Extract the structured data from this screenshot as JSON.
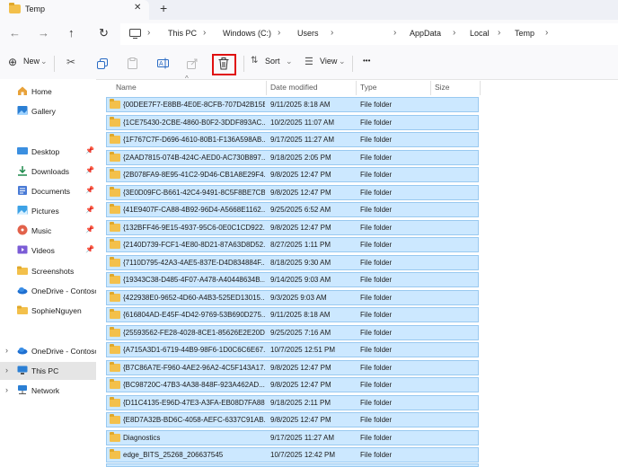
{
  "tab": {
    "title": "Temp",
    "close": "✕",
    "new": "+"
  },
  "nav": {
    "back": "←",
    "forward": "→",
    "up": "↑",
    "refresh": "↻"
  },
  "breadcrumb": [
    {
      "label": "This PC"
    },
    {
      "label": "Windows (C:)"
    },
    {
      "label": "Users"
    },
    {
      "label": "AppData"
    },
    {
      "label": "Local"
    },
    {
      "label": "Temp"
    }
  ],
  "toolbar": {
    "new_label": "New",
    "sort_label": "Sort",
    "view_label": "View",
    "more": "•••"
  },
  "sidebar": [
    {
      "label": "Home",
      "icon": "home-icon"
    },
    {
      "label": "Gallery",
      "icon": "gallery-icon"
    },
    {
      "label": "Desktop",
      "icon": "desktop-icon",
      "pinned": true
    },
    {
      "label": "Downloads",
      "icon": "downloads-icon",
      "pinned": true
    },
    {
      "label": "Documents",
      "icon": "documents-icon",
      "pinned": true
    },
    {
      "label": "Pictures",
      "icon": "pictures-icon",
      "pinned": true
    },
    {
      "label": "Music",
      "icon": "music-icon",
      "pinned": true
    },
    {
      "label": "Videos",
      "icon": "videos-icon",
      "pinned": true
    },
    {
      "label": "Screenshots",
      "icon": "folder-icon"
    },
    {
      "label": "OneDrive - Contoso",
      "icon": "onedrive-icon"
    },
    {
      "label": "SophieNguyen",
      "icon": "folder-icon"
    },
    {
      "label": "OneDrive - Contoso",
      "icon": "onedrive-icon",
      "expander": true
    },
    {
      "label": "This PC",
      "icon": "pc-icon",
      "expander": true,
      "selected": true
    },
    {
      "label": "Network",
      "icon": "network-icon",
      "expander": true
    }
  ],
  "columns": {
    "name": "Name",
    "date": "Date modified",
    "type": "Type",
    "size": "Size"
  },
  "files": [
    {
      "name": "{00DEE7F7-E8BB-4E0E-8CFB-707D42B15B...",
      "date": "9/11/2025 8:18 AM",
      "type": "File folder"
    },
    {
      "name": "{1CE75430-2CBE-4860-B0F2-3DDF893AC...",
      "date": "10/2/2025 11:07 AM",
      "type": "File folder"
    },
    {
      "name": "{1F767C7F-D696-4610-80B1-F136A598AB...",
      "date": "9/17/2025 11:27 AM",
      "type": "File folder"
    },
    {
      "name": "{2AAD7815-074B-424C-AED0-AC730B897...",
      "date": "9/18/2025 2:05 PM",
      "type": "File folder"
    },
    {
      "name": "{2B078FA9-8E95-41C2-9D46-CB1A8E29F4...",
      "date": "9/8/2025 12:47 PM",
      "type": "File folder"
    },
    {
      "name": "{3E0D09FC-B661-42C4-9491-8C5F8BE7CB...",
      "date": "9/8/2025 12:47 PM",
      "type": "File folder"
    },
    {
      "name": "{41E9407F-CA88-4B92-96D4-A5668E1162...",
      "date": "9/25/2025 6:52 AM",
      "type": "File folder"
    },
    {
      "name": "{132BFF46-9E15-4937-95C6-0E0C1CD922...",
      "date": "9/8/2025 12:47 PM",
      "type": "File folder"
    },
    {
      "name": "{2140D739-FCF1-4E80-8D21-87A63D8D52...",
      "date": "8/27/2025 1:11 PM",
      "type": "File folder"
    },
    {
      "name": "{7110D795-42A3-4AE5-837E-D4D834884F...",
      "date": "8/18/2025 9:30 AM",
      "type": "File folder"
    },
    {
      "name": "{19343C38-D485-4F07-A478-A40448634B...",
      "date": "9/14/2025 9:03 AM",
      "type": "File folder"
    },
    {
      "name": "{422938E0-9652-4D60-A4B3-525ED13015...",
      "date": "9/3/2025 9:03 AM",
      "type": "File folder"
    },
    {
      "name": "{616804AD-E45F-4D42-9769-53B690D275...",
      "date": "9/11/2025 8:18 AM",
      "type": "File folder"
    },
    {
      "name": "{25593562-FE28-4028-8CE1-85626E2E20D0}",
      "date": "9/25/2025 7:16 AM",
      "type": "File folder"
    },
    {
      "name": "{A715A3D1-6719-44B9-98F6-1D0C6C6E67...",
      "date": "10/7/2025 12:51 PM",
      "type": "File folder"
    },
    {
      "name": "{B7C86A7E-F960-4AE2-96A2-4C5F143A17...",
      "date": "9/8/2025 12:47 PM",
      "type": "File folder"
    },
    {
      "name": "{BC98720C-47B3-4A38-848F-923A462AD...",
      "date": "9/8/2025 12:47 PM",
      "type": "File folder"
    },
    {
      "name": "{D11C4135-E96D-47E3-A3FA-EB08D7FA88...",
      "date": "9/18/2025 2:11 PM",
      "type": "File folder"
    },
    {
      "name": "{E8D7A32B-BD6C-4058-AEFC-6337C91AB...",
      "date": "9/8/2025 12:47 PM",
      "type": "File folder"
    },
    {
      "name": "Diagnostics",
      "date": "9/17/2025 11:27 AM",
      "type": "File folder"
    },
    {
      "name": "edge_BITS_25268_206637545",
      "date": "10/7/2025 12:42 PM",
      "type": "File folder"
    }
  ],
  "colors": {
    "selection": "#cce8ff",
    "selection_border": "#99c9f0",
    "highlight": "#e01010",
    "folder": "#f3c04b"
  }
}
